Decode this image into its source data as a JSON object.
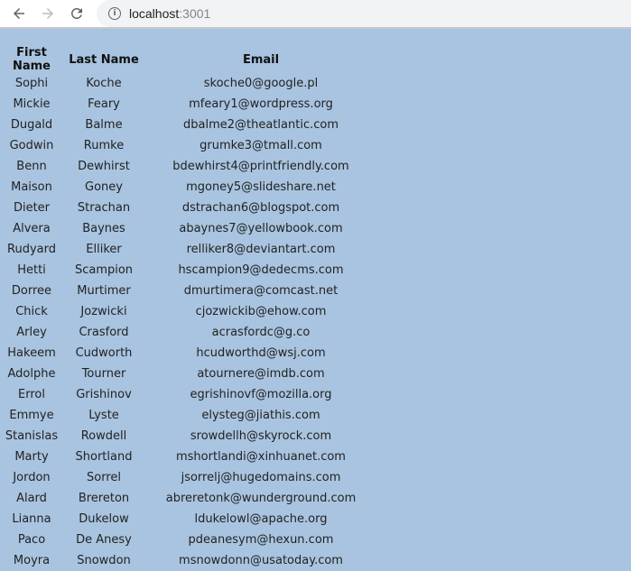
{
  "browser": {
    "url_host": "localhost",
    "url_port": ":3001",
    "icons": {
      "back": "arrow-left-icon",
      "forward": "arrow-right-icon",
      "reload": "reload-icon",
      "info": "info-icon"
    }
  },
  "colors": {
    "page_background": "#a9c4e0",
    "omnibox_background": "#f1f3f4",
    "text": "#222222"
  },
  "table": {
    "headers": [
      "First Name",
      "Last Name",
      "Email"
    ],
    "rows": [
      [
        "Sophi",
        "Koche",
        "skoche0@google.pl"
      ],
      [
        "Mickie",
        "Feary",
        "mfeary1@wordpress.org"
      ],
      [
        "Dugald",
        "Balme",
        "dbalme2@theatlantic.com"
      ],
      [
        "Godwin",
        "Rumke",
        "grumke3@tmall.com"
      ],
      [
        "Benn",
        "Dewhirst",
        "bdewhirst4@printfriendly.com"
      ],
      [
        "Maison",
        "Goney",
        "mgoney5@slideshare.net"
      ],
      [
        "Dieter",
        "Strachan",
        "dstrachan6@blogspot.com"
      ],
      [
        "Alvera",
        "Baynes",
        "abaynes7@yellowbook.com"
      ],
      [
        "Rudyard",
        "Elliker",
        "relliker8@deviantart.com"
      ],
      [
        "Hetti",
        "Scampion",
        "hscampion9@dedecms.com"
      ],
      [
        "Dorree",
        "Murtimer",
        "dmurtimera@comcast.net"
      ],
      [
        "Chick",
        "Jozwicki",
        "cjozwickib@ehow.com"
      ],
      [
        "Arley",
        "Crasford",
        "acrasfordc@g.co"
      ],
      [
        "Hakeem",
        "Cudworth",
        "hcudworthd@wsj.com"
      ],
      [
        "Adolphe",
        "Tourner",
        "atournere@imdb.com"
      ],
      [
        "Errol",
        "Grishinov",
        "egrishinovf@mozilla.org"
      ],
      [
        "Emmye",
        "Lyste",
        "elysteg@jiathis.com"
      ],
      [
        "Stanislas",
        "Rowdell",
        "srowdellh@skyrock.com"
      ],
      [
        "Marty",
        "Shortland",
        "mshortlandi@xinhuanet.com"
      ],
      [
        "Jordon",
        "Sorrel",
        "jsorrelj@hugedomains.com"
      ],
      [
        "Alard",
        "Brereton",
        "abreretonk@wunderground.com"
      ],
      [
        "Lianna",
        "Dukelow",
        "ldukelowl@apache.org"
      ],
      [
        "Paco",
        "De Anesy",
        "pdeanesym@hexun.com"
      ],
      [
        "Moyra",
        "Snowdon",
        "msnowdonn@usatoday.com"
      ]
    ]
  }
}
